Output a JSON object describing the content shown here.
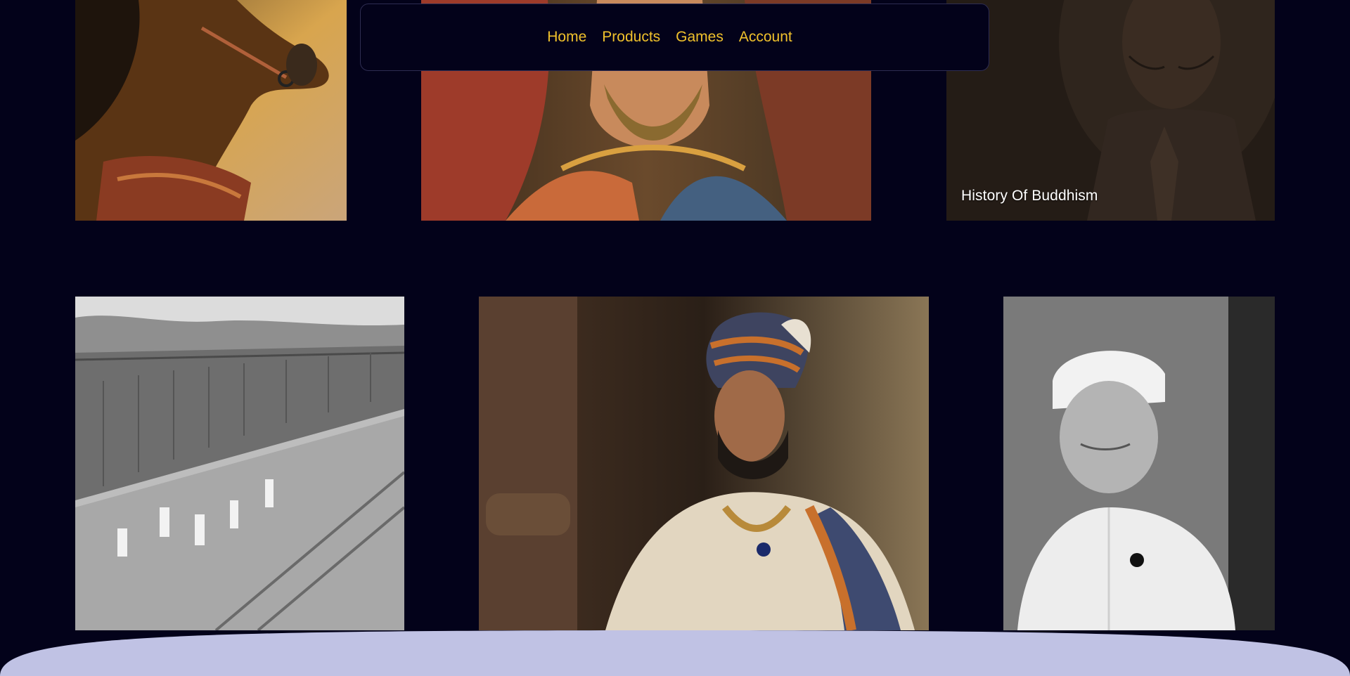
{
  "nav": {
    "items": [
      {
        "label": "Home"
      },
      {
        "label": "Products"
      },
      {
        "label": "Games"
      },
      {
        "label": "Account"
      }
    ]
  },
  "tiles": {
    "horse": {
      "label": ""
    },
    "queen": {
      "label": ""
    },
    "buddhism": {
      "label": "History Of Buddhism"
    },
    "partition": {
      "label": ""
    },
    "king": {
      "label": ""
    },
    "leader": {
      "label": ""
    }
  },
  "colors": {
    "background": "#03021a",
    "nav_link": "#f0c12c",
    "nav_border": "#2e2d52",
    "footer_curve": "#c0c2e4",
    "label": "#ffffff"
  }
}
